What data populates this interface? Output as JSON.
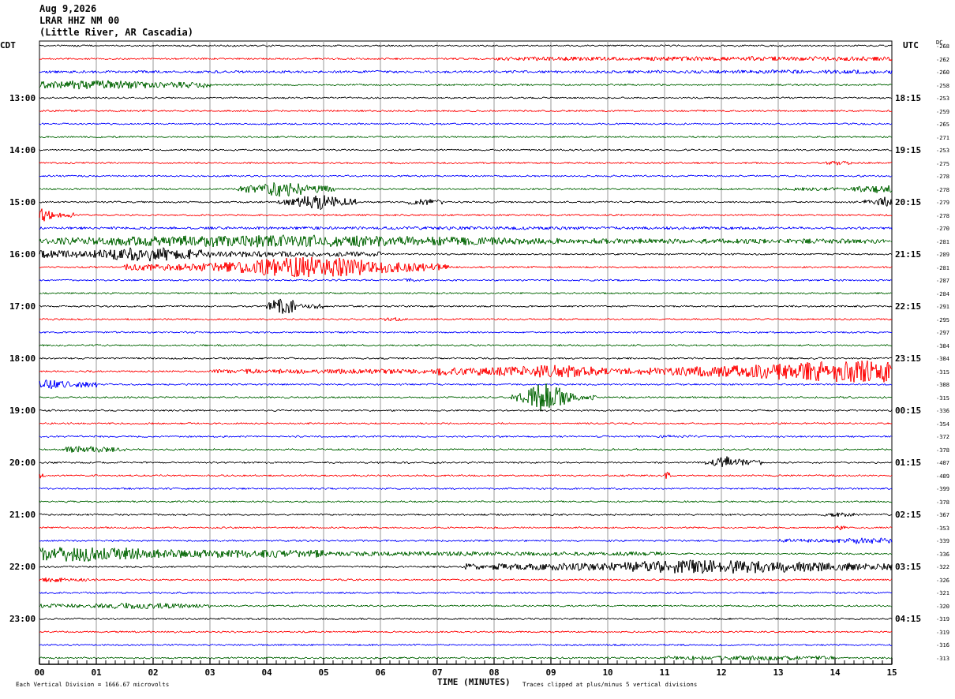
{
  "header": [
    "Aug 9,2026",
    "LRAR HHZ NM 00",
    "(Little River, AR Cascadia)"
  ],
  "left_zone": "CDT",
  "right_zone": "UTC",
  "dc_header": "DC",
  "rows": [
    {
      "dc": "-268",
      "color": "#000000"
    },
    {
      "dc": "-262",
      "color": "#ff0000"
    },
    {
      "dc": "-260",
      "color": "#0000ff"
    },
    {
      "dc": "-258",
      "color": "#006400"
    },
    {
      "dc": "-253",
      "color": "#000000",
      "cdt": "13:00",
      "utc": "18:15"
    },
    {
      "dc": "-259",
      "color": "#ff0000"
    },
    {
      "dc": "-265",
      "color": "#0000ff"
    },
    {
      "dc": "-271",
      "color": "#006400"
    },
    {
      "dc": "-253",
      "color": "#000000",
      "cdt": "14:00",
      "utc": "19:15"
    },
    {
      "dc": "-275",
      "color": "#ff0000"
    },
    {
      "dc": "-278",
      "color": "#0000ff"
    },
    {
      "dc": "-278",
      "color": "#006400"
    },
    {
      "dc": "-279",
      "color": "#000000",
      "cdt": "15:00",
      "utc": "20:15"
    },
    {
      "dc": "-278",
      "color": "#ff0000"
    },
    {
      "dc": "-270",
      "color": "#0000ff"
    },
    {
      "dc": "-281",
      "color": "#006400"
    },
    {
      "dc": "-289",
      "color": "#000000",
      "cdt": "16:00",
      "utc": "21:15"
    },
    {
      "dc": "-281",
      "color": "#ff0000"
    },
    {
      "dc": "-287",
      "color": "#0000ff"
    },
    {
      "dc": "-284",
      "color": "#006400"
    },
    {
      "dc": "-291",
      "color": "#000000",
      "cdt": "17:00",
      "utc": "22:15"
    },
    {
      "dc": "-295",
      "color": "#ff0000"
    },
    {
      "dc": "-297",
      "color": "#0000ff"
    },
    {
      "dc": "-304",
      "color": "#006400"
    },
    {
      "dc": "-304",
      "color": "#000000",
      "cdt": "18:00",
      "utc": "23:15"
    },
    {
      "dc": "-315",
      "color": "#ff0000"
    },
    {
      "dc": "-308",
      "color": "#0000ff"
    },
    {
      "dc": "-315",
      "color": "#006400"
    },
    {
      "dc": "-336",
      "color": "#000000",
      "cdt": "19:00",
      "utc": "00:15"
    },
    {
      "dc": "-354",
      "color": "#ff0000"
    },
    {
      "dc": "-372",
      "color": "#0000ff"
    },
    {
      "dc": "-378",
      "color": "#006400"
    },
    {
      "dc": "-407",
      "color": "#000000",
      "cdt": "20:00",
      "utc": "01:15"
    },
    {
      "dc": "-409",
      "color": "#ff0000"
    },
    {
      "dc": "-399",
      "color": "#0000ff"
    },
    {
      "dc": "-378",
      "color": "#006400"
    },
    {
      "dc": "-367",
      "color": "#000000",
      "cdt": "21:00",
      "utc": "02:15"
    },
    {
      "dc": "-353",
      "color": "#ff0000"
    },
    {
      "dc": "-339",
      "color": "#0000ff"
    },
    {
      "dc": "-336",
      "color": "#006400"
    },
    {
      "dc": "-322",
      "color": "#000000",
      "cdt": "22:00",
      "utc": "03:15"
    },
    {
      "dc": "-326",
      "color": "#ff0000"
    },
    {
      "dc": "-321",
      "color": "#0000ff"
    },
    {
      "dc": "-320",
      "color": "#006400"
    },
    {
      "dc": "-319",
      "color": "#000000",
      "cdt": "23:00",
      "utc": "04:15"
    },
    {
      "dc": "-319",
      "color": "#ff0000"
    },
    {
      "dc": "-316",
      "color": "#0000ff"
    },
    {
      "dc": "-313",
      "color": "#006400"
    }
  ],
  "x_ticks": [
    "00",
    "01",
    "02",
    "03",
    "04",
    "05",
    "06",
    "07",
    "08",
    "09",
    "10",
    "11",
    "12",
    "13",
    "14",
    "15"
  ],
  "x_axis_title": "TIME (MINUTES)",
  "footer_left": "Each Vertical Division = 1666.67 microvolts",
  "footer_right": "Traces clipped at plus/minus 5 vertical divisions"
}
